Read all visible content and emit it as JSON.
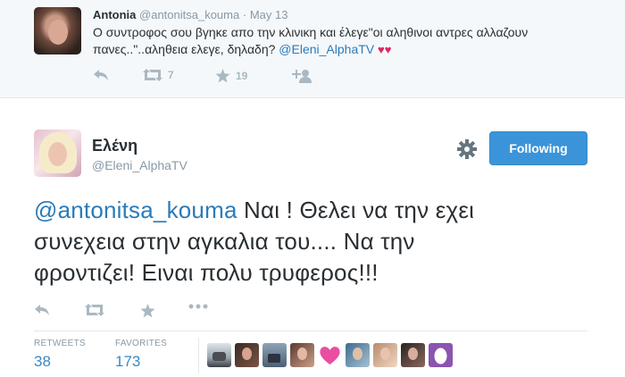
{
  "reply": {
    "author_name": "Antonia",
    "author_handle": "@antonitsa_kouma",
    "separator": "·",
    "date": "May 13",
    "text_line1": "Ο συντροφος σου βγηκε απο την κλινικη και έλεγε\"οι αληθινοι αντρες αλλαζουν",
    "text_line2": "πανες..\"..αληθεια ελεγε, δηλαδη?",
    "text_mention": "@Eleni_AlphaTV",
    "hearts": "♥♥",
    "retweet_count": "7",
    "favorite_count": "19",
    "icons": [
      "reply-icon",
      "retweet-icon",
      "favorite-icon",
      "follow-icon"
    ]
  },
  "tweet": {
    "author_name": "Ελένη",
    "author_handle": "@Eleni_AlphaTV",
    "follow_label": "Following",
    "mention": "@antonitsa_kouma",
    "text_line1": " Ναι ! Θελει να την εχει",
    "text_line2": "συνεχεια στην αγκαλια του.... Να την",
    "text_line3": "φροντιζει! Ειναι πολυ τρυφερος!!!",
    "icons": [
      "reply-icon",
      "retweet-icon",
      "favorite-icon",
      "more-icon",
      "gear-icon"
    ]
  },
  "stats": {
    "retweets_label": "RETWEETS",
    "retweets_value": "38",
    "favorites_label": "FAVORITES",
    "favorites_value": "173"
  },
  "favorited_avatars": 9,
  "colors": {
    "link": "#2b7bb9",
    "button": "#3b94d9",
    "icon": "#aab8c2",
    "heart": "#e0245e",
    "stat_value": "#3b88c3"
  }
}
